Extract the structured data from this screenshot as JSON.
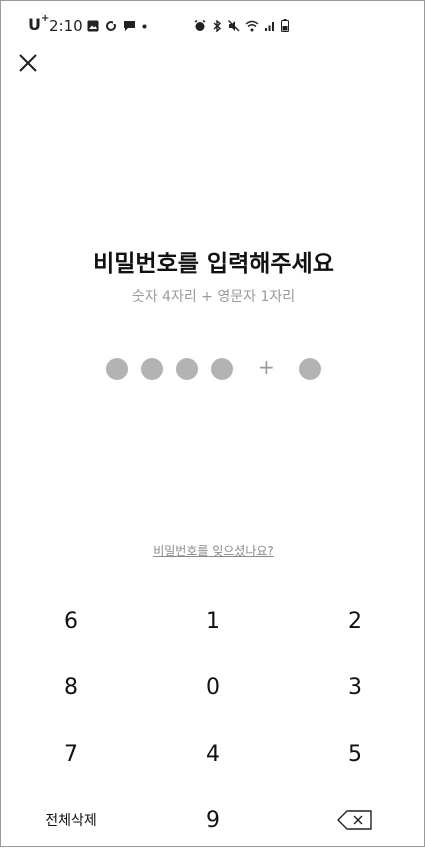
{
  "status_bar": {
    "carrier": "U",
    "carrier_sup": "+",
    "time": "2:10"
  },
  "title": "비밀번호를 입력해주세요",
  "subtitle": "숫자 4자리 + 영문자 1자리",
  "pin": {
    "digits_filled": 4,
    "digits_total": 4,
    "separator": "+",
    "letters_filled": 1
  },
  "forgot_link": "비밀번호를 잊으셨나요?",
  "keypad": {
    "rows": [
      [
        "6",
        "1",
        "2"
      ],
      [
        "8",
        "0",
        "3"
      ],
      [
        "7",
        "4",
        "5"
      ],
      [
        "전체삭제",
        "9",
        "backspace-icon"
      ]
    ]
  },
  "colors": {
    "dot": "#b3b3b3",
    "subtitle": "#9a9a9a"
  }
}
